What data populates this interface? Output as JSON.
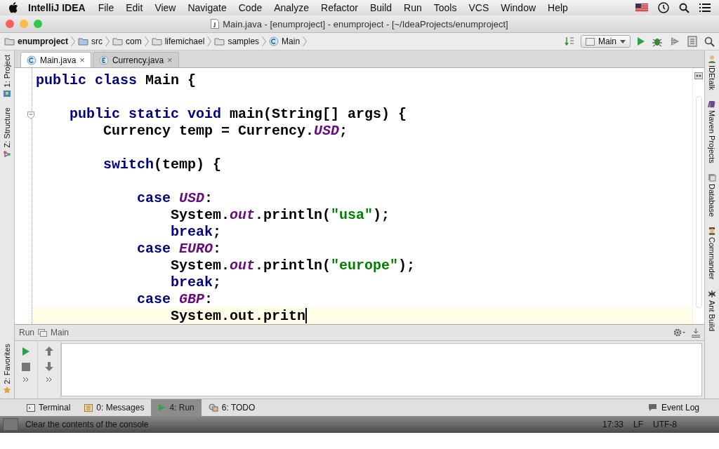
{
  "menu_bar": {
    "app": "IntelliJ IDEA",
    "items": [
      "File",
      "Edit",
      "View",
      "Navigate",
      "Code",
      "Analyze",
      "Refactor",
      "Build",
      "Run",
      "Tools",
      "VCS",
      "Window",
      "Help"
    ]
  },
  "window": {
    "title": "Main.java - [enumproject] - enumproject - [~/IdeaProjects/enumproject]"
  },
  "breadcrumbs": [
    {
      "label": "enumproject",
      "kind": "project"
    },
    {
      "label": "src",
      "kind": "folder"
    },
    {
      "label": "com",
      "kind": "package"
    },
    {
      "label": "lifemichael",
      "kind": "package"
    },
    {
      "label": "samples",
      "kind": "package"
    },
    {
      "label": "Main",
      "kind": "class"
    }
  ],
  "run_config": {
    "label": "Main"
  },
  "tabs": [
    {
      "label": "Main.java",
      "kind": "class",
      "selected": true,
      "close": "×"
    },
    {
      "label": "Currency.java",
      "kind": "enum",
      "selected": false,
      "close": "×"
    }
  ],
  "left_tool_tabs": [
    {
      "label": "1: Project",
      "kind": "project"
    },
    {
      "label": "Z: Structure",
      "kind": "structure"
    }
  ],
  "left_bottom_tool_tabs": [
    {
      "label": "2: Favorites",
      "kind": "favorites"
    }
  ],
  "right_tool_tabs": [
    {
      "label": "IDEtalk",
      "kind": "person"
    },
    {
      "label": "Maven Projects",
      "kind": "maven"
    },
    {
      "label": "Database",
      "kind": "database"
    },
    {
      "label": "Commander",
      "kind": "commander"
    },
    {
      "label": "Ant Build",
      "kind": "ant"
    }
  ],
  "code_lines": [
    {
      "current": false,
      "tokens": [
        {
          "text": "public class ",
          "kind": "keyword"
        },
        {
          "text": "Main {",
          "kind": "plain"
        }
      ]
    },
    {
      "kind": "blank"
    },
    {
      "current": false,
      "tokens": [
        {
          "text": "    public static void ",
          "kind": "keyword"
        },
        {
          "text": "main(String[] args) {",
          "kind": "plain"
        }
      ]
    },
    {
      "current": false,
      "tokens": [
        {
          "text": "        Currency temp = Currency.",
          "kind": "plain"
        },
        {
          "text": "USD",
          "kind": "field"
        },
        {
          "text": ";",
          "kind": "plain"
        }
      ]
    },
    {
      "kind": "blank"
    },
    {
      "current": false,
      "tokens": [
        {
          "text": "        switch",
          "kind": "keyword"
        },
        {
          "text": "(temp) {",
          "kind": "plain"
        }
      ]
    },
    {
      "kind": "blank"
    },
    {
      "current": false,
      "tokens": [
        {
          "text": "            case ",
          "kind": "keyword"
        },
        {
          "text": "USD",
          "kind": "field"
        },
        {
          "text": ":",
          "kind": "plain"
        }
      ]
    },
    {
      "current": false,
      "tokens": [
        {
          "text": "                System.",
          "kind": "plain"
        },
        {
          "text": "out",
          "kind": "field"
        },
        {
          "text": ".println(",
          "kind": "plain"
        },
        {
          "text": "\"usa\"",
          "kind": "string"
        },
        {
          "text": ");",
          "kind": "plain"
        }
      ]
    },
    {
      "current": false,
      "tokens": [
        {
          "text": "                break",
          "kind": "keyword"
        },
        {
          "text": ";",
          "kind": "plain"
        }
      ]
    },
    {
      "current": false,
      "tokens": [
        {
          "text": "            case ",
          "kind": "keyword"
        },
        {
          "text": "EURO",
          "kind": "field"
        },
        {
          "text": ":",
          "kind": "plain"
        }
      ]
    },
    {
      "current": false,
      "tokens": [
        {
          "text": "                System.",
          "kind": "plain"
        },
        {
          "text": "out",
          "kind": "field"
        },
        {
          "text": ".println(",
          "kind": "plain"
        },
        {
          "text": "\"europe\"",
          "kind": "string"
        },
        {
          "text": ");",
          "kind": "plain"
        }
      ]
    },
    {
      "current": false,
      "tokens": [
        {
          "text": "                break",
          "kind": "keyword"
        },
        {
          "text": ";",
          "kind": "plain"
        }
      ]
    },
    {
      "current": false,
      "tokens": [
        {
          "text": "            case ",
          "kind": "keyword"
        },
        {
          "text": "GBP",
          "kind": "field"
        },
        {
          "text": ":",
          "kind": "plain"
        }
      ]
    },
    {
      "current": true,
      "tokens": [
        {
          "text": "                System.out.pritn",
          "kind": "plain"
        }
      ]
    }
  ],
  "run_panel": {
    "label": "Run",
    "config": "Main"
  },
  "bottom_tool_tabs": [
    {
      "label": "Terminal",
      "kind": "terminal",
      "selected": false
    },
    {
      "label": "0: Messages",
      "kind": "messages",
      "selected": false
    },
    {
      "label": "4: Run",
      "kind": "run",
      "selected": true
    },
    {
      "label": "6: TODO",
      "kind": "todo",
      "selected": false
    }
  ],
  "event_log": {
    "label": "Event Log"
  },
  "status_bar": {
    "message": "Clear the contents of the console",
    "time": "17:33",
    "line_separator": "LF",
    "encoding": "UTF-8"
  }
}
